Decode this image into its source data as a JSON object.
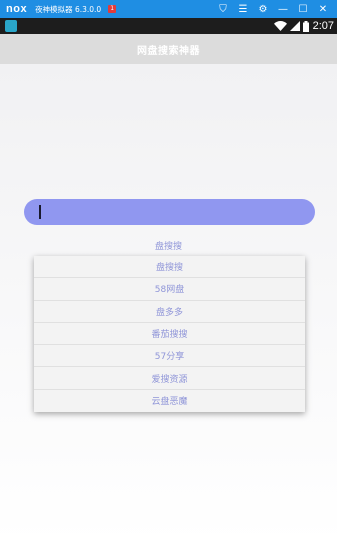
{
  "emulator": {
    "logo": "nox",
    "title": "夜神模拟器 6.3.0.0",
    "badge": "1",
    "controls": [
      {
        "name": "shirt-icon",
        "glyph": "⛉"
      },
      {
        "name": "menu-icon",
        "glyph": "☰"
      },
      {
        "name": "gear-icon",
        "glyph": "⚙"
      },
      {
        "name": "minimize-icon",
        "glyph": "—"
      },
      {
        "name": "maximize-icon",
        "glyph": "☐"
      },
      {
        "name": "close-icon",
        "glyph": "✕"
      }
    ]
  },
  "status_bar": {
    "time": "2:07"
  },
  "action_bar": {
    "title": "网盘搜索神器"
  },
  "search": {
    "value": ""
  },
  "engine": {
    "selected": "盘搜搜",
    "options": [
      "盘搜搜",
      "58网盘",
      "盘多多",
      "番茄搜搜",
      "57分享",
      "爱搜资源",
      "云盘恶魔"
    ]
  },
  "colors": {
    "emulator_bar": "#1f8ee3",
    "status_bar": "#1d1d1d",
    "action_bar": "#dcdcdc",
    "search_box": "#9097f0",
    "accent_text": "#8f95d8"
  }
}
